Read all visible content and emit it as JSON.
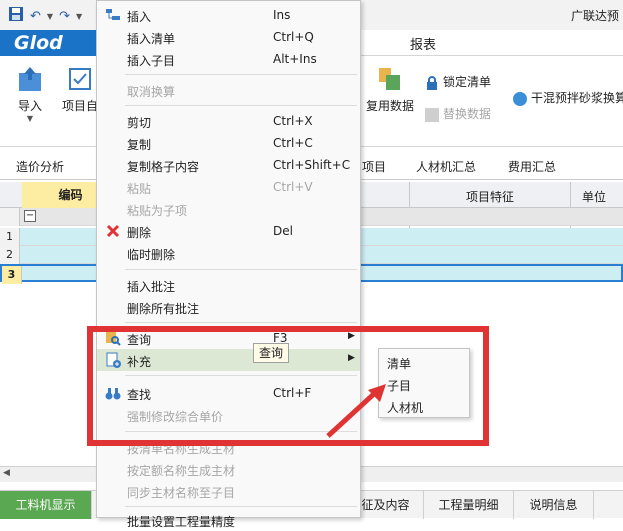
{
  "app_title": "广联达预",
  "logo_text": "Glod",
  "menubar": {
    "report_tab": "报表"
  },
  "ribbon": {
    "import_label": "导入",
    "project_label": "项目自",
    "reuse_data_label": "复用数据",
    "lock_list_label": "锁定清单",
    "replace_data_label": "替换数据",
    "dry_mortar_label": "干混预拌砂浆换算"
  },
  "tabs2": {
    "cost_analysis": "造价分析",
    "project": "项目",
    "labor_material_summary": "人材机汇总",
    "fee_summary": "费用汇总"
  },
  "grid": {
    "header_code": "编码",
    "header_feature": "项目特征",
    "header_unit": "单位",
    "collapse_symbol": "−",
    "row_numbers": [
      "1",
      "2",
      "3"
    ]
  },
  "bottom_tabs": {
    "labor_display": "工料机显示",
    "features_content": "征及内容",
    "quantity_detail": "工程量明细",
    "description": "说明信息"
  },
  "context_menu": {
    "insert": {
      "label": "插入",
      "shortcut": "Ins"
    },
    "insert_list": {
      "label": "插入清单",
      "shortcut": "Ctrl+Q"
    },
    "insert_child": {
      "label": "插入子目",
      "shortcut": "Alt+Ins"
    },
    "cancel_swap": {
      "label": "取消换算"
    },
    "cut": {
      "label": "剪切",
      "shortcut": "Ctrl+X"
    },
    "copy": {
      "label": "复制",
      "shortcut": "Ctrl+C"
    },
    "copy_cell": {
      "label": "复制格子内容",
      "shortcut": "Ctrl+Shift+C"
    },
    "paste": {
      "label": "粘贴",
      "shortcut": "Ctrl+V"
    },
    "paste_child": {
      "label": "粘贴为子项"
    },
    "delete": {
      "label": "删除",
      "shortcut": "Del"
    },
    "temp_delete": {
      "label": "临时删除"
    },
    "insert_note": {
      "label": "插入批注"
    },
    "delete_notes": {
      "label": "删除所有批注"
    },
    "query": {
      "label": "查询",
      "shortcut": "F3"
    },
    "supplement": {
      "label": "补充"
    },
    "find": {
      "label": "查找",
      "shortcut": "Ctrl+F"
    },
    "force_modify": {
      "label": "强制修改综合单价"
    },
    "gen_main_by_list": {
      "label": "按清单名称生成主材"
    },
    "gen_main_by_quota": {
      "label": "按定额名称生成主材"
    },
    "sync_main_name": {
      "label": "同步主材名称至子目"
    },
    "batch_set": {
      "label": "批量设置工程量精度"
    }
  },
  "tooltip": "查询",
  "submenu": {
    "items": [
      "清单",
      "子目",
      "人材机"
    ]
  },
  "colors": {
    "annotation_red": "#e03434",
    "logo_blue": "#1a73c7",
    "highlight": "#dde8d4"
  }
}
